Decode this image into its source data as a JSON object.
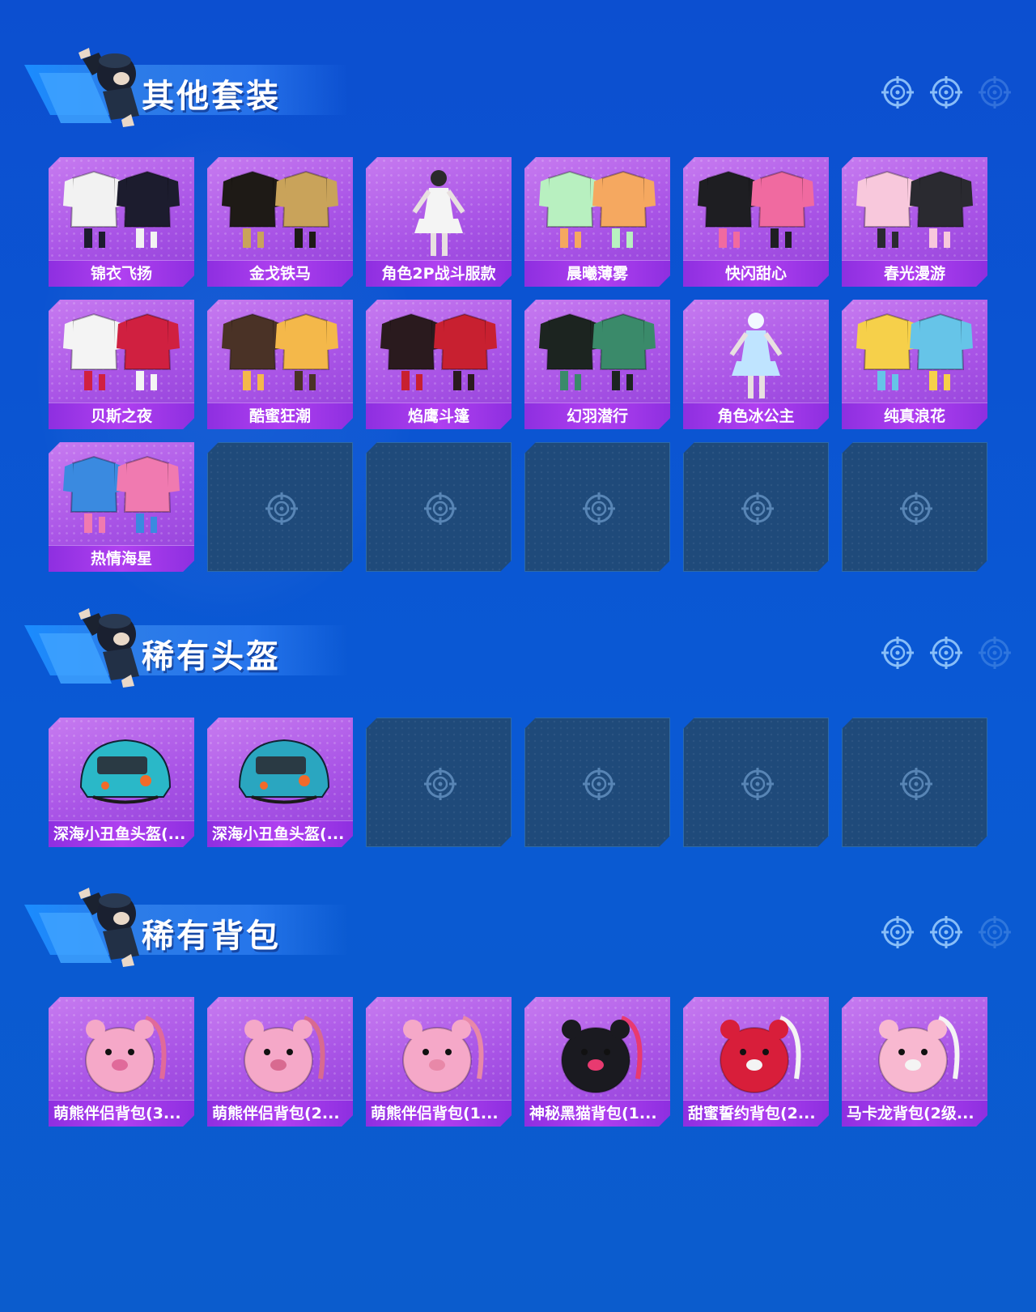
{
  "sections": [
    {
      "title": "其他套装",
      "items": [
        {
          "label": "锦衣飞扬",
          "icon": "white-robe-outfit-icon",
          "colors": [
            "#f2f2f2",
            "#1c1c2e"
          ]
        },
        {
          "label": "金戈铁马",
          "icon": "black-gold-armor-outfit-icon",
          "colors": [
            "#1e1a16",
            "#c9a35a"
          ]
        },
        {
          "label": "角色2P战斗服款",
          "icon": "white-battle-dress-character-icon",
          "colors": [
            "#f4f4f4",
            "#2a2a2a"
          ]
        },
        {
          "label": "晨曦薄雾",
          "icon": "pastel-hanfu-outfit-icon",
          "colors": [
            "#b8f0c0",
            "#f5a860"
          ]
        },
        {
          "label": "快闪甜心",
          "icon": "black-pink-heart-jacket-icon",
          "colors": [
            "#1e1e22",
            "#f06aa0"
          ]
        },
        {
          "label": "春光漫游",
          "icon": "pink-cardigan-outfit-icon",
          "colors": [
            "#f8c8dc",
            "#2a2a30"
          ]
        },
        {
          "label": "贝斯之夜",
          "icon": "white-red-punk-outfit-icon",
          "colors": [
            "#f4f4f4",
            "#d02040"
          ]
        },
        {
          "label": "酷蜜狂潮",
          "icon": "brown-yellow-street-outfit-icon",
          "colors": [
            "#4a3226",
            "#f4b84a"
          ]
        },
        {
          "label": "焰鹰斗篷",
          "icon": "red-black-hooded-cloak-icon",
          "colors": [
            "#2a1a1e",
            "#c82030"
          ]
        },
        {
          "label": "幻羽潜行",
          "icon": "black-green-ninja-outfit-icon",
          "colors": [
            "#1c2420",
            "#3a8a6a"
          ]
        },
        {
          "label": "角色冰公主",
          "icon": "ice-princess-dress-character-icon",
          "colors": [
            "#bfe4ff",
            "#f2f8ff"
          ]
        },
        {
          "label": "纯真浪花",
          "icon": "splash-float-outfit-icon",
          "colors": [
            "#f6d04a",
            "#66c4e8"
          ]
        },
        {
          "label": "热情海星",
          "icon": "blue-pink-starfish-outfit-icon",
          "colors": [
            "#3a8ae0",
            "#f07ab0"
          ]
        }
      ],
      "empty_count": 5
    },
    {
      "title": "稀有头盔",
      "items": [
        {
          "label": "深海小丑鱼头盔(...",
          "icon": "clownfish-level3-helmet-icon",
          "colors": [
            "#2ab8c8",
            "#f26a2a"
          ]
        },
        {
          "label": "深海小丑鱼头盔(...",
          "icon": "clownfish-level1-helmet-icon",
          "colors": [
            "#2aa6c0",
            "#f26a2a"
          ]
        }
      ],
      "empty_count": 4
    },
    {
      "title": "稀有背包",
      "items": [
        {
          "label": "萌熊伴侣背包(3...",
          "icon": "pink-bear-backpack-icon",
          "colors": [
            "#f5a8c8",
            "#e06a9a"
          ]
        },
        {
          "label": "萌熊伴侣背包(2...",
          "icon": "pink-bear-backpack-icon",
          "colors": [
            "#f5a8c8",
            "#d86a90"
          ]
        },
        {
          "label": "萌熊伴侣背包(1...",
          "icon": "pink-bear-backpack-icon",
          "colors": [
            "#f5a8c8",
            "#e888a8"
          ]
        },
        {
          "label": "神秘黑猫背包(1...",
          "icon": "black-cat-backpack-icon",
          "colors": [
            "#1a1a20",
            "#e83a70"
          ]
        },
        {
          "label": "甜蜜誓约背包(2...",
          "icon": "red-bow-heart-backpack-icon",
          "colors": [
            "#d81e3a",
            "#f4f4f4"
          ]
        },
        {
          "label": "马卡龙背包(2级...",
          "icon": "pink-macaron-backpack-icon",
          "colors": [
            "#f8b8d0",
            "#f4f4f4"
          ]
        }
      ],
      "empty_count": 0
    }
  ],
  "header_reticles": [
    "crosshair-icon",
    "crosshair-icon",
    "crosshair-faded-icon"
  ],
  "theme": {
    "background": "#0b55d0",
    "card_purple": "#a954e6",
    "label_purple": "#9a36e8",
    "empty_slot": "#1f4a7a"
  }
}
